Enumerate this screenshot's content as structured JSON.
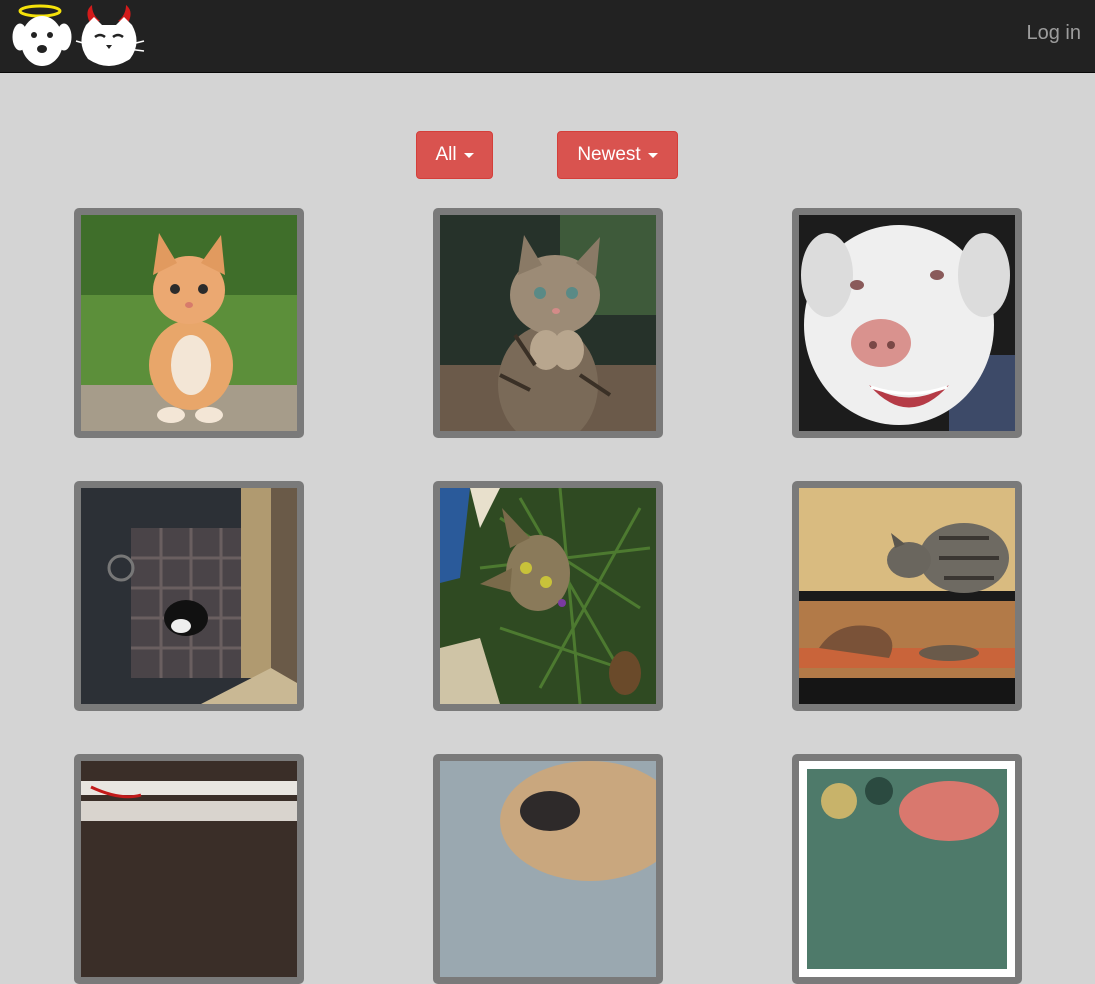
{
  "navbar": {
    "login_label": "Log in",
    "logo_icon": "angel-dog-devil-cat-logo"
  },
  "filters": {
    "category_label": "All",
    "sort_label": "Newest"
  },
  "colors": {
    "navbar_bg": "#222222",
    "page_bg": "#d4d4d4",
    "button_red": "#d9534f",
    "tile_frame": "#7a7a7a"
  },
  "gallery": {
    "tiles": [
      {
        "subject": "orange kitten sitting on grass"
      },
      {
        "subject": "tabby kitten with paws raised"
      },
      {
        "subject": "white dog smiling"
      },
      {
        "subject": "black and white cat behind glass"
      },
      {
        "subject": "tabby cat in christmas tree"
      },
      {
        "subject": "tabby cat on shelf in terrarium"
      },
      {
        "subject": "photo partially visible"
      },
      {
        "subject": "photo partially visible"
      },
      {
        "subject": "photo partially visible"
      }
    ]
  }
}
